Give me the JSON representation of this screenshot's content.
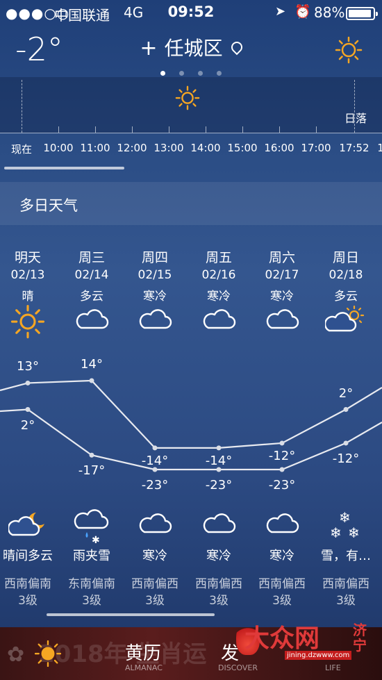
{
  "status_bar": {
    "signal": "●●●○○",
    "carrier": "中国联通",
    "network": "4G",
    "time": "09:52",
    "battery": "88%"
  },
  "header": {
    "current_temp": "-2°",
    "plus_symbol": "+",
    "city": "任城区",
    "weather_icon": "sun-icon"
  },
  "page_dots": {
    "count": 4,
    "active": 0
  },
  "hourly": {
    "sunset_label": "日落",
    "hours": [
      "现在",
      "10:00",
      "11:00",
      "12:00",
      "13:00",
      "14:00",
      "15:00",
      "16:00",
      "17:00",
      "17:52",
      "1"
    ]
  },
  "multi_day": {
    "title": "多日天气",
    "days": [
      {
        "name": "明天",
        "date": "02/13",
        "day_cond": "晴",
        "day_icon": "sun-icon",
        "high": "13°",
        "low": "2°",
        "night_icon": "cloud-moon-icon",
        "night_cond": "晴间多云",
        "wind": "西南偏南",
        "level": "3级"
      },
      {
        "name": "周三",
        "date": "02/14",
        "day_cond": "多云",
        "day_icon": "cloud-icon",
        "high": "14°",
        "low": "-17°",
        "night_icon": "sleet-icon",
        "night_cond": "雨夹雪",
        "wind": "东南偏南",
        "level": "3级"
      },
      {
        "name": "周四",
        "date": "02/15",
        "day_cond": "寒冷",
        "day_icon": "cloud-icon",
        "high": "-14°",
        "low": "-23°",
        "night_icon": "cloud-icon",
        "night_cond": "寒冷",
        "wind": "西南偏西",
        "level": "3级"
      },
      {
        "name": "周五",
        "date": "02/16",
        "day_cond": "寒冷",
        "day_icon": "cloud-icon",
        "high": "-14°",
        "low": "-23°",
        "night_icon": "cloud-icon",
        "night_cond": "寒冷",
        "wind": "西南偏西",
        "level": "3级"
      },
      {
        "name": "周六",
        "date": "02/17",
        "day_cond": "寒冷",
        "day_icon": "cloud-icon",
        "high": "-12°",
        "low": "-23°",
        "night_icon": "cloud-icon",
        "night_cond": "寒冷",
        "wind": "西南偏西",
        "level": "3级"
      },
      {
        "name": "周日",
        "date": "02/18",
        "day_cond": "多云",
        "day_icon": "cloud-sun-icon",
        "high": "2°",
        "low": "-12°",
        "night_icon": "snow-icon",
        "night_cond": "雪，有…",
        "wind": "西南偏西",
        "level": "3级"
      }
    ]
  },
  "tab_bar": {
    "background_text": "2018年 生肖运",
    "tabs": [
      {
        "label": "黄历",
        "sub": "ALMANAC"
      },
      {
        "label": "发",
        "sub": "DISCOVER"
      },
      {
        "label": "",
        "sub": "LIFE"
      }
    ]
  },
  "watermark": {
    "logo_text": "大众网",
    "city_mark": "济宁",
    "url": "jining.dzwww.com"
  },
  "colors": {
    "sun": "#f5a623",
    "background_top": "#1f3f78",
    "background_bottom": "#1d3566",
    "line": "#e8eaf0"
  }
}
